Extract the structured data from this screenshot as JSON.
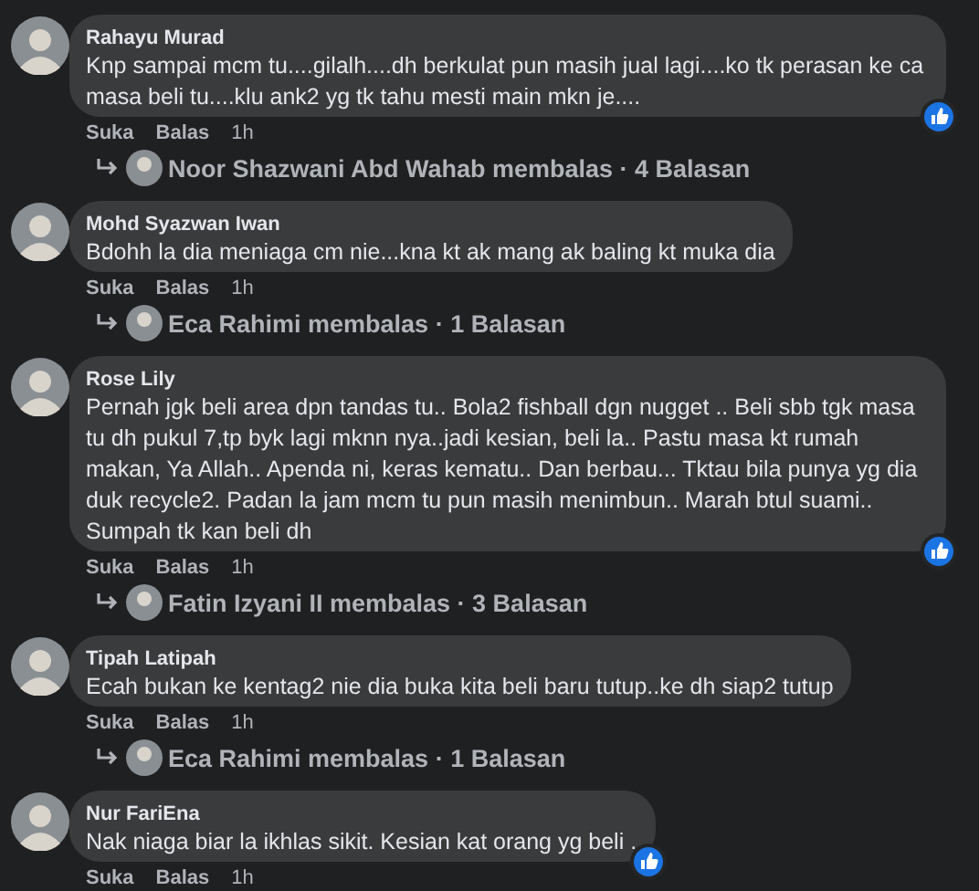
{
  "comments": [
    {
      "author": "Rahayu Murad",
      "text": "Knp sampai mcm tu....gilalh....dh berkulat pun masih jual lagi....ko tk perasan ke ca masa beli tu....klu ank2 yg tk tahu mesti main mkn je....",
      "like": "Suka",
      "reply": "Balas",
      "time": "1h",
      "reacted": true,
      "replies": "Noor Shazwani Abd Wahab membalas · 4 Balasan"
    },
    {
      "author": "Mohd Syazwan Iwan",
      "text": "Bdohh la dia meniaga cm nie...kna kt ak mang ak baling kt muka dia",
      "like": "Suka",
      "reply": "Balas",
      "time": "1h",
      "reacted": false,
      "replies": "Eca Rahimi membalas · 1 Balasan"
    },
    {
      "author": "Rose Lily",
      "text": "Pernah jgk beli area dpn tandas tu.. Bola2 fishball dgn nugget .. Beli sbb tgk masa tu dh pukul 7,tp byk lagi mknn nya..jadi kesian, beli la.. Pastu masa kt rumah makan, Ya Allah.. Apenda ni, keras kematu.. Dan berbau... Tktau bila punya yg dia duk recycle2. Padan la jam mcm tu pun masih menimbun.. Marah btul suami.. Sumpah tk kan beli dh",
      "like": "Suka",
      "reply": "Balas",
      "time": "1h",
      "reacted": true,
      "replies": "Fatin Izyani II membalas · 3 Balasan"
    },
    {
      "author": "Tipah Latipah",
      "text": "Ecah bukan ke kentag2 nie dia buka kita beli baru tutup..ke dh siap2 tutup",
      "like": "Suka",
      "reply": "Balas",
      "time": "1h",
      "reacted": false,
      "replies": "Eca Rahimi membalas · 1 Balasan"
    },
    {
      "author": "Nur FariEna",
      "text": "Nak niaga biar la ikhlas sikit. Kesian kat orang yg beli .",
      "like": "Suka",
      "reply": "Balas",
      "time": "1h",
      "reacted": true
    }
  ]
}
